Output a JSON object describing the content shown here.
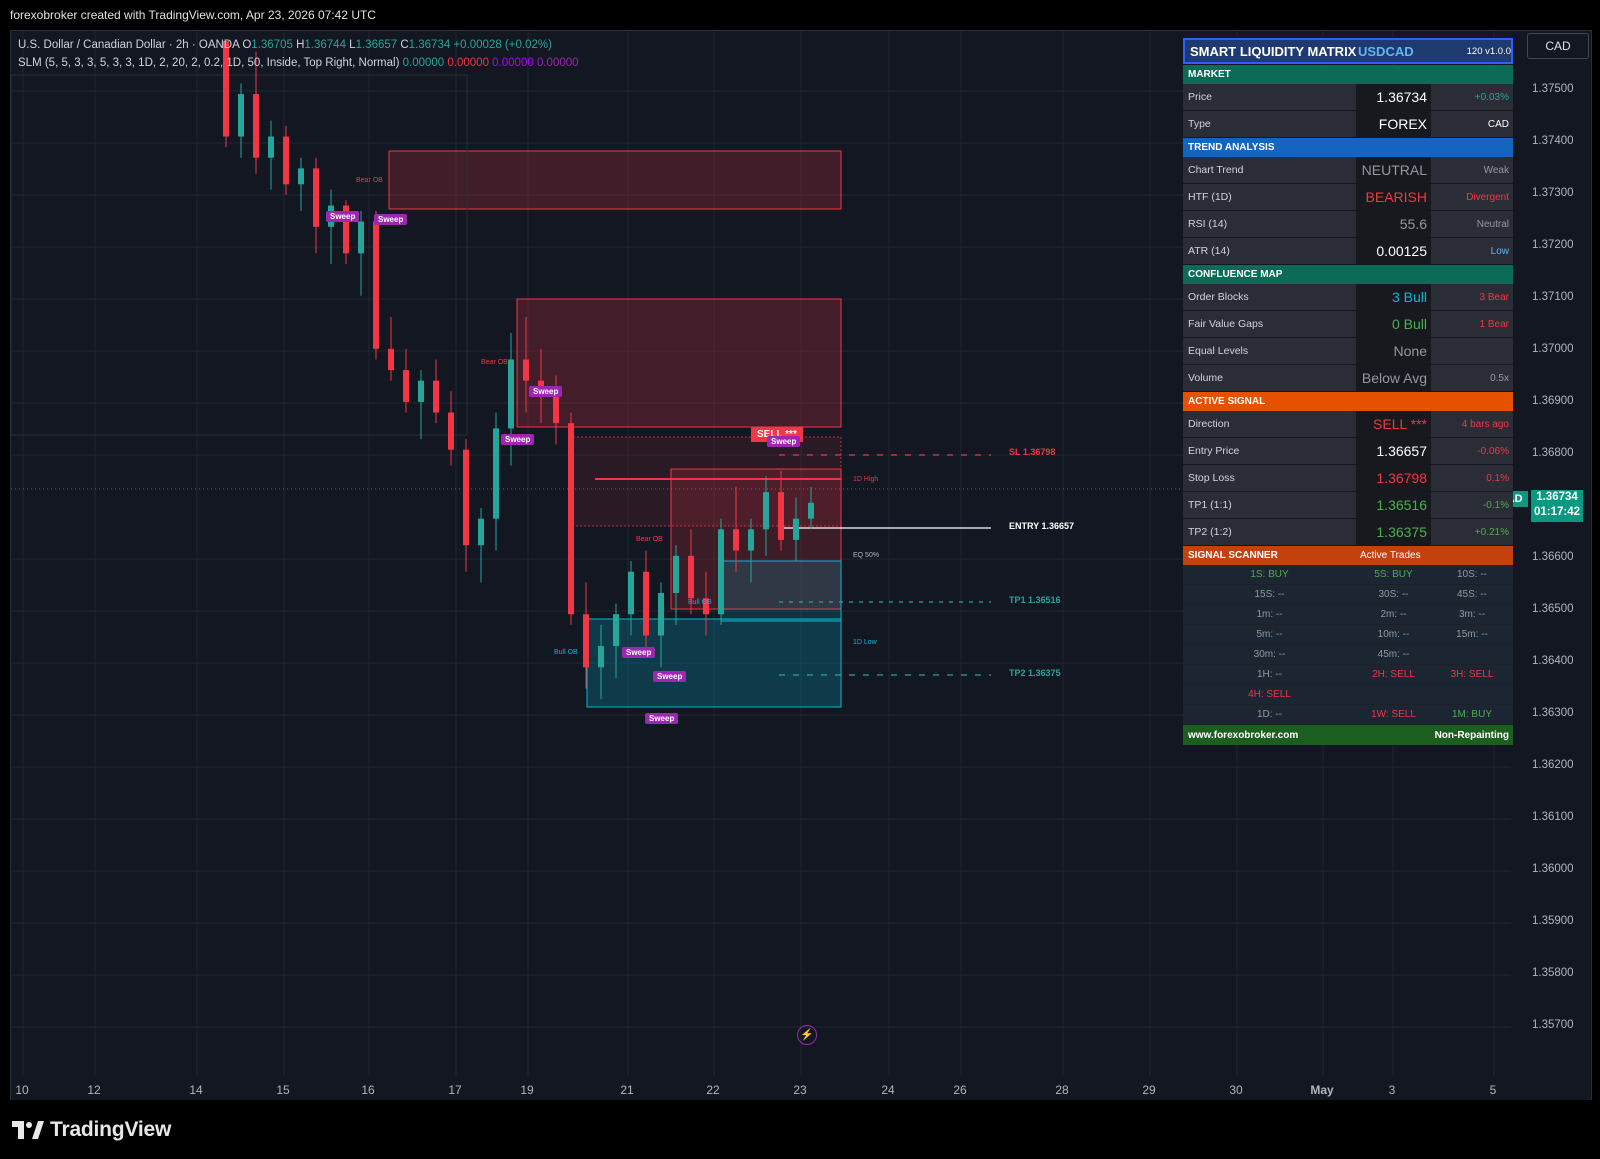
{
  "header": {
    "credit": "forexobroker created with TradingView.com, Apr 23, 2026 07:42 UTC"
  },
  "legend": {
    "symbol_line": "U.S. Dollar / Canadian Dollar · 2h · OANDA",
    "o_label": "O",
    "o_val": "1.36705",
    "h_label": "H",
    "h_val": "1.36744",
    "l_label": "L",
    "l_val": "1.36657",
    "c_label": "C",
    "c_val": "1.36734",
    "change": "+0.00028 (+0.02%)",
    "indicator": "SLM (5, 5, 3, 3, 5, 3, 3, 1D, 2, 20, 2, 0.2, 1D, 50, Inside, Top Right, Normal)",
    "v1": "0.00000",
    "v2": "0.00000",
    "v3": "0.00000",
    "v4": "0.00000"
  },
  "colors": {
    "bull": "#26a69a",
    "bear": "#f23645",
    "bg": "#131722",
    "grid": "#1f2430",
    "accent_purple": "#9c27b0",
    "bull_zone": "#00bcd4",
    "bear_zone": "#f23645"
  },
  "price_axis": {
    "currency_button": "CAD",
    "ticks": [
      "1.37500",
      "1.37400",
      "1.37300",
      "1.37200",
      "1.37100",
      "1.37000",
      "1.36900",
      "1.36800",
      "1.36600",
      "1.36500",
      "1.36400",
      "1.36300",
      "1.36200",
      "1.36100",
      "1.36000",
      "1.35900",
      "1.35800",
      "1.35700"
    ],
    "current_symbol": "USDCAD",
    "current_price": "1.36734",
    "countdown": "01:17:42"
  },
  "time_axis": {
    "labels": [
      "10",
      "12",
      "14",
      "15",
      "16",
      "17",
      "19",
      "21",
      "22",
      "23",
      "24",
      "26",
      "28",
      "29",
      "30",
      "May",
      "3",
      "5"
    ]
  },
  "annotations": {
    "sl": "SL 1.36798",
    "entry": "ENTRY 1.36657",
    "tp1": "TP1 1.36516",
    "tp2": "TP2 1.36375",
    "sell": "SELL ***",
    "sweep": "Sweep",
    "bear_ob": "Bear OB",
    "bull_ob": "Bull OB",
    "d_high": "1D High",
    "eq": "EQ 50%",
    "d_low": "1D Low"
  },
  "panel": {
    "title": "SMART LIQUIDITY MATRIX",
    "pair": "USDCAD",
    "meta": "120  v1.0.0",
    "sections": {
      "market": "MARKET",
      "trend": "TREND ANALYSIS",
      "confluence": "CONFLUENCE MAP",
      "signal": "ACTIVE SIGNAL",
      "scanner": "SIGNAL SCANNER",
      "scanner_right": "Active Trades"
    },
    "rows": {
      "price": [
        "Price",
        "1.36734",
        "+0.03%"
      ],
      "type": [
        "Type",
        "FOREX",
        "CAD"
      ],
      "chart_trend": [
        "Chart Trend",
        "NEUTRAL",
        "Weak"
      ],
      "htf": [
        "HTF (1D)",
        "BEARISH",
        "Divergent"
      ],
      "rsi": [
        "RSI (14)",
        "55.6",
        "Neutral"
      ],
      "atr": [
        "ATR (14)",
        "0.00125",
        "Low"
      ],
      "ob": [
        "Order Blocks",
        "3 Bull",
        "3 Bear"
      ],
      "fvg": [
        "Fair Value Gaps",
        "0 Bull",
        "1 Bear"
      ],
      "eq": [
        "Equal Levels",
        "None",
        ""
      ],
      "vol": [
        "Volume",
        "Below Avg",
        "0.5x"
      ],
      "dir": [
        "Direction",
        "SELL ***",
        "4 bars ago"
      ],
      "entry": [
        "Entry Price",
        "1.36657",
        "-0.06%"
      ],
      "sl": [
        "Stop Loss",
        "1.36798",
        "0.1%"
      ],
      "tp1": [
        "TP1 (1:1)",
        "1.36516",
        "-0.1%"
      ],
      "tp2": [
        "TP2 (1:2)",
        "1.36375",
        "+0.21%"
      ]
    },
    "scanner": [
      [
        "1S: BUY",
        "5S: BUY",
        "10S: --"
      ],
      [
        "15S: --",
        "30S: --",
        "45S: --"
      ],
      [
        "1m: --",
        "2m: --",
        "3m: --"
      ],
      [
        "5m: --",
        "10m: --",
        "15m: --"
      ],
      [
        "30m: --",
        "45m: --",
        ""
      ],
      [
        "1H: --",
        "2H: SELL",
        "3H: SELL"
      ],
      [
        "4H: SELL",
        "",
        ""
      ],
      [
        "1D: --",
        "1W: SELL",
        "1M: BUY"
      ]
    ],
    "footer_left": "www.forexobroker.com",
    "footer_right": "Non-Repainting"
  },
  "brand": {
    "logo_text": "TradingView",
    "logo_icon": "tradingview-logo-icon"
  },
  "chart_data": {
    "type": "candlestick",
    "ylim": [
      1.3565,
      1.376
    ],
    "candles": [
      [
        1.376,
        1.376,
        1.374,
        1.3742
      ],
      [
        1.3742,
        1.3752,
        1.3738,
        1.375
      ],
      [
        1.375,
        1.3758,
        1.3735,
        1.3738
      ],
      [
        1.3738,
        1.3745,
        1.3732,
        1.3742
      ],
      [
        1.3742,
        1.3744,
        1.3731,
        1.3733
      ],
      [
        1.3733,
        1.3738,
        1.3728,
        1.3736
      ],
      [
        1.3736,
        1.3738,
        1.372,
        1.3725
      ],
      [
        1.3725,
        1.3732,
        1.3718,
        1.3729
      ],
      [
        1.3729,
        1.373,
        1.3718,
        1.372
      ],
      [
        1.372,
        1.3728,
        1.3712,
        1.3726
      ],
      [
        1.3726,
        1.3728,
        1.37,
        1.3702
      ],
      [
        1.3702,
        1.3708,
        1.3696,
        1.3698
      ],
      [
        1.3698,
        1.3702,
        1.369,
        1.3692
      ],
      [
        1.3692,
        1.3698,
        1.3685,
        1.3696
      ],
      [
        1.3696,
        1.37,
        1.3688,
        1.369
      ],
      [
        1.369,
        1.3694,
        1.368,
        1.3683
      ],
      [
        1.3683,
        1.3685,
        1.366,
        1.3665
      ],
      [
        1.3665,
        1.3672,
        1.3658,
        1.367
      ],
      [
        1.367,
        1.369,
        1.3664,
        1.3687
      ],
      [
        1.3687,
        1.3705,
        1.368,
        1.37
      ],
      [
        1.37,
        1.3708,
        1.369,
        1.3696
      ],
      [
        1.3696,
        1.3702,
        1.3688,
        1.3694
      ],
      [
        1.3694,
        1.3697,
        1.3684,
        1.3688
      ],
      [
        1.3688,
        1.369,
        1.365,
        1.3652
      ],
      [
        1.3652,
        1.3658,
        1.3638,
        1.3642
      ],
      [
        1.3642,
        1.365,
        1.3636,
        1.3646
      ],
      [
        1.3646,
        1.3654,
        1.364,
        1.3652
      ],
      [
        1.3652,
        1.3662,
        1.3648,
        1.366
      ],
      [
        1.366,
        1.3664,
        1.3644,
        1.3648
      ],
      [
        1.3648,
        1.3658,
        1.3642,
        1.3656
      ],
      [
        1.3656,
        1.3665,
        1.365,
        1.3663
      ],
      [
        1.3663,
        1.3668,
        1.3652,
        1.3655
      ],
      [
        1.3655,
        1.366,
        1.3648,
        1.3652
      ],
      [
        1.3652,
        1.367,
        1.365,
        1.3668
      ],
      [
        1.3668,
        1.3676,
        1.366,
        1.3664
      ],
      [
        1.3664,
        1.367,
        1.3658,
        1.3668
      ],
      [
        1.3668,
        1.3678,
        1.3663,
        1.3675
      ],
      [
        1.3675,
        1.3679,
        1.3664,
        1.3666
      ],
      [
        1.3666,
        1.3674,
        1.3662,
        1.367
      ],
      [
        1.367,
        1.3676,
        1.3668,
        1.3673
      ]
    ]
  }
}
